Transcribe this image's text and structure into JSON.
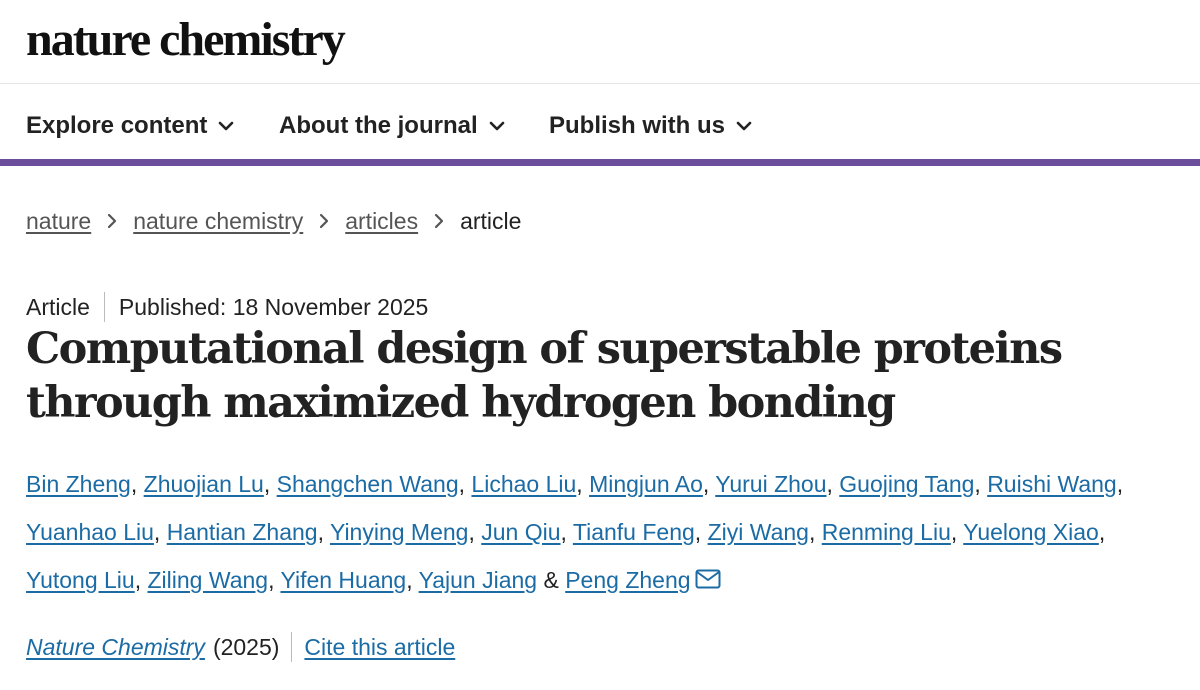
{
  "site": {
    "logo": "nature chemistry"
  },
  "nav": {
    "items": [
      {
        "label": "Explore content"
      },
      {
        "label": "About the journal"
      },
      {
        "label": "Publish with us"
      }
    ]
  },
  "breadcrumb": {
    "items": [
      "nature",
      "nature chemistry",
      "articles"
    ],
    "current": "article"
  },
  "article": {
    "type": "Article",
    "published": "Published: 18 November 2025",
    "title": "Computational design of superstable proteins through maximized hydrogen bonding",
    "authors": [
      "Bin Zheng",
      "Zhuojian Lu",
      "Shangchen Wang",
      "Lichao Liu",
      "Mingjun Ao",
      "Yurui Zhou",
      "Guojing Tang",
      "Ruishi Wang",
      "Yuanhao Liu",
      "Hantian Zhang",
      "Yinying Meng",
      "Jun Qiu",
      "Tianfu Feng",
      "Ziyi Wang",
      "Renming Liu",
      "Yuelong Xiao",
      "Yutong Liu",
      "Ziling Wang",
      "Yifen Huang",
      "Yajun Jiang",
      "Peng Zheng"
    ],
    "journal": "Nature Chemistry",
    "year": "(2025)",
    "cite_label": "Cite this article"
  },
  "colors": {
    "accent": "#6b4f9c",
    "link": "#1b6ba5"
  },
  "icons": {
    "nav_chevron": "chevron-down-icon",
    "breadcrumb_sep": "chevron-right-icon",
    "corresponding": "mail-icon"
  }
}
